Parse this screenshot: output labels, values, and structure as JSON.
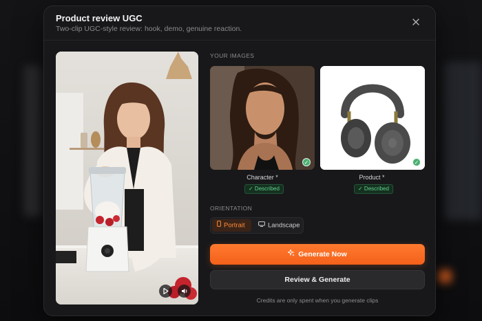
{
  "modal": {
    "title": "Product review UGC",
    "subtitle": "Two-clip UGC-style review: hook, demo, genuine reaction.",
    "close_icon": "×"
  },
  "images": {
    "section_label": "YOUR IMAGES",
    "character": {
      "label": "Character *",
      "status": "✓ Described"
    },
    "product": {
      "label": "Product *",
      "status": "✓ Described"
    }
  },
  "orientation": {
    "section_label": "ORIENTATION",
    "options": [
      {
        "label": "Portrait",
        "selected": true
      },
      {
        "label": "Landscape",
        "selected": false
      }
    ]
  },
  "actions": {
    "generate_label": "Generate Now",
    "review_label": "Review & Generate",
    "footnote": "Credits are only spent when you generate clips"
  },
  "colors": {
    "accent": "#f4601a",
    "success": "#5fd38d",
    "modal_bg": "#18181a"
  }
}
